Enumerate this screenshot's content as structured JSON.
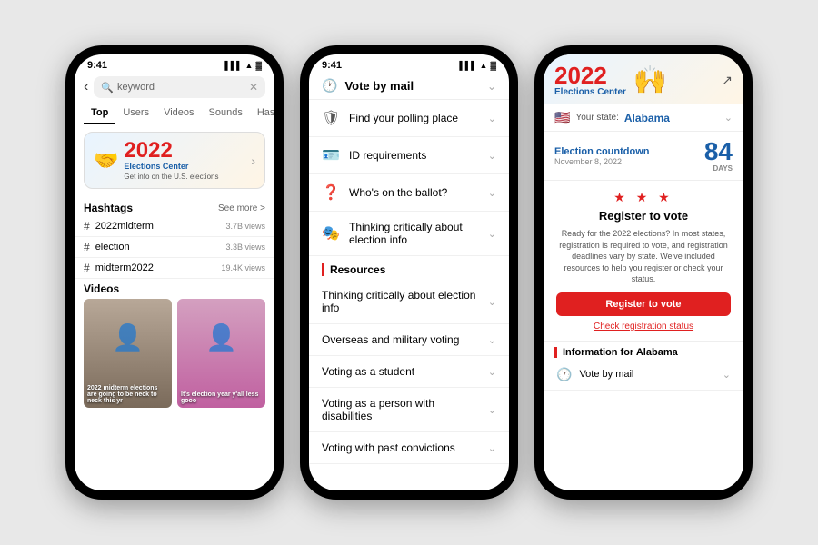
{
  "background": "#e8e8e8",
  "phone1": {
    "status_time": "9:41",
    "search_placeholder": "keyword",
    "tabs": [
      "Top",
      "Users",
      "Videos",
      "Sounds",
      "Hashtags"
    ],
    "active_tab": "Top",
    "elections_year": "2022",
    "elections_center": "Elections Center",
    "elections_sub": "Get info on the U.S. elections",
    "hashtags_title": "Hashtags",
    "see_more": "See more >",
    "hashtags": [
      {
        "name": "#2022midterm",
        "views": "3.7B views"
      },
      {
        "name": "#election",
        "views": "3.3B views"
      },
      {
        "name": "#midterm2022",
        "views": "19.4K views"
      }
    ],
    "videos_title": "Videos",
    "video1_caption": "2022 midterm elections are going to be neck to neck this yr",
    "video2_caption": "It's election year y'all less gooo"
  },
  "phone2": {
    "status_time": "9:41",
    "header_title": "Vote by mail",
    "menu_items": [
      {
        "icon": "🛡",
        "text": "Find your polling place"
      },
      {
        "icon": "🪪",
        "text": "ID requirements"
      },
      {
        "icon": "❓",
        "text": "Who's on the ballot?"
      },
      {
        "icon": "🎭",
        "text": "Thinking critically about election info"
      }
    ],
    "resources_title": "Resources",
    "resource_items": [
      {
        "text": "Thinking critically about election info"
      },
      {
        "text": "Overseas and military voting"
      },
      {
        "text": "Voting as a student"
      },
      {
        "text": "Voting as a person with disabilities"
      },
      {
        "text": "Voting with past convictions"
      }
    ]
  },
  "phone3": {
    "status_time": "9:41",
    "elections_year": "2022",
    "elections_center": "Elections Center",
    "state_label": "Your state:",
    "state_name": "Alabama",
    "countdown_title": "Election countdown",
    "countdown_date": "November 8, 2022",
    "countdown_number": "84",
    "countdown_days": "DAYS",
    "stars": "★ ★ ★",
    "register_title": "Register to vote",
    "register_text": "Ready for the 2022 elections? In most states, registration is required to vote, and registration deadlines vary by state. We've included resources to help you register or check your status.",
    "register_btn": "Register to vote",
    "check_status": "Check registration status",
    "info_header": "Information for Alabama",
    "vote_by_mail": "Vote by mail"
  }
}
